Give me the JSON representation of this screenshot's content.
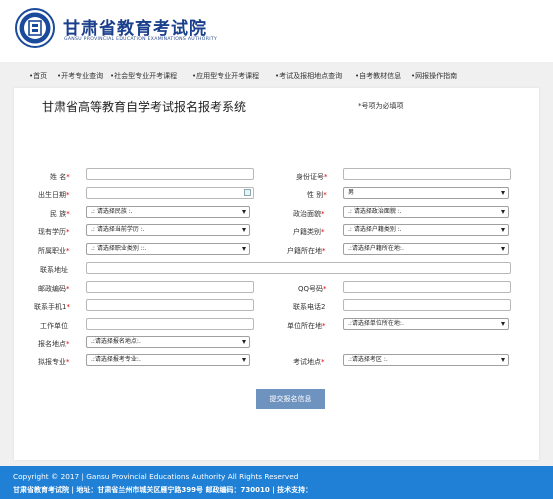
{
  "header": {
    "site_title": "甘肃省教育考试院",
    "site_subtitle": "GANSU PROVINCIAL EDUCATION EXAMINATIONS AUTHORITY",
    "logo_icon": "exam-authority-seal-icon",
    "brand_color": "#1a3f8c"
  },
  "nav": {
    "items": [
      "•首页",
      "•开考专业查询",
      "•社会型专业开考课程",
      "•应用型专业开考课程",
      "•考试及报相地点查询",
      "•自考教材信息",
      "•网报操作指南"
    ]
  },
  "form": {
    "title": "甘肃省高等教育自学考试报名报考系统",
    "required_note": "*号项为必填项",
    "fields": {
      "name": {
        "label": "姓 名",
        "required": "*"
      },
      "id_number": {
        "label": "身份证号",
        "required": "*"
      },
      "birth_date": {
        "label": "出生日期",
        "required": "*"
      },
      "gender": {
        "label": "性 别",
        "required": "*",
        "value": "男"
      },
      "ethnicity": {
        "label": "民 族",
        "required": "*",
        "value": ".: 请选择民族 :."
      },
      "political_status": {
        "label": "政治面貌",
        "required": "*",
        "value": ".: 请选择政治面貌 :."
      },
      "education": {
        "label": "现有学历",
        "required": "*",
        "value": ".: 请选择当前学历 :."
      },
      "hukou_type": {
        "label": "户籍类别",
        "required": "*",
        "value": ".: 请选择户籍类别 :."
      },
      "occupation": {
        "label": "所属职业",
        "required": "*",
        "value": ".: 请选择职业类别 ::."
      },
      "hukou_location": {
        "label": "户籍所在地",
        "required": "*",
        "value": ".:请选择户籍所在地:."
      },
      "address": {
        "label": "联系地址",
        "required": ""
      },
      "postal_code": {
        "label": "邮政编码",
        "required": "*"
      },
      "qq": {
        "label": "QQ号码",
        "required": "*"
      },
      "mobile": {
        "label": "联系手机1",
        "required": "*"
      },
      "phone2": {
        "label": "联系电话2",
        "required": ""
      },
      "work_unit": {
        "label": "工作单位",
        "required": ""
      },
      "work_location": {
        "label": "单位所在地",
        "required": "*",
        "value": ".:请选择单位所在地:."
      },
      "exam_site": {
        "label": "报名地点",
        "required": "*",
        "value": ".:请选择报名地点:."
      },
      "major": {
        "label": "拟报专业",
        "required": "*",
        "value": ".:请选择报考专业:."
      },
      "exam_area": {
        "label": "考试地点",
        "required": "*",
        "value": ".:请选择考区 :."
      }
    },
    "submit_label": "提交报名信息",
    "submit_color": "#6f93bf"
  },
  "footer": {
    "copyright": "Copyright © 2017 | Gansu Provincial Educations Authority All Rights Reserved",
    "contact": "甘肃省教育考试院 | 地址：甘肃省兰州市城关区雁宁路399号 邮政编码：730010 | 技术支持：",
    "color": "#1f80d6"
  }
}
